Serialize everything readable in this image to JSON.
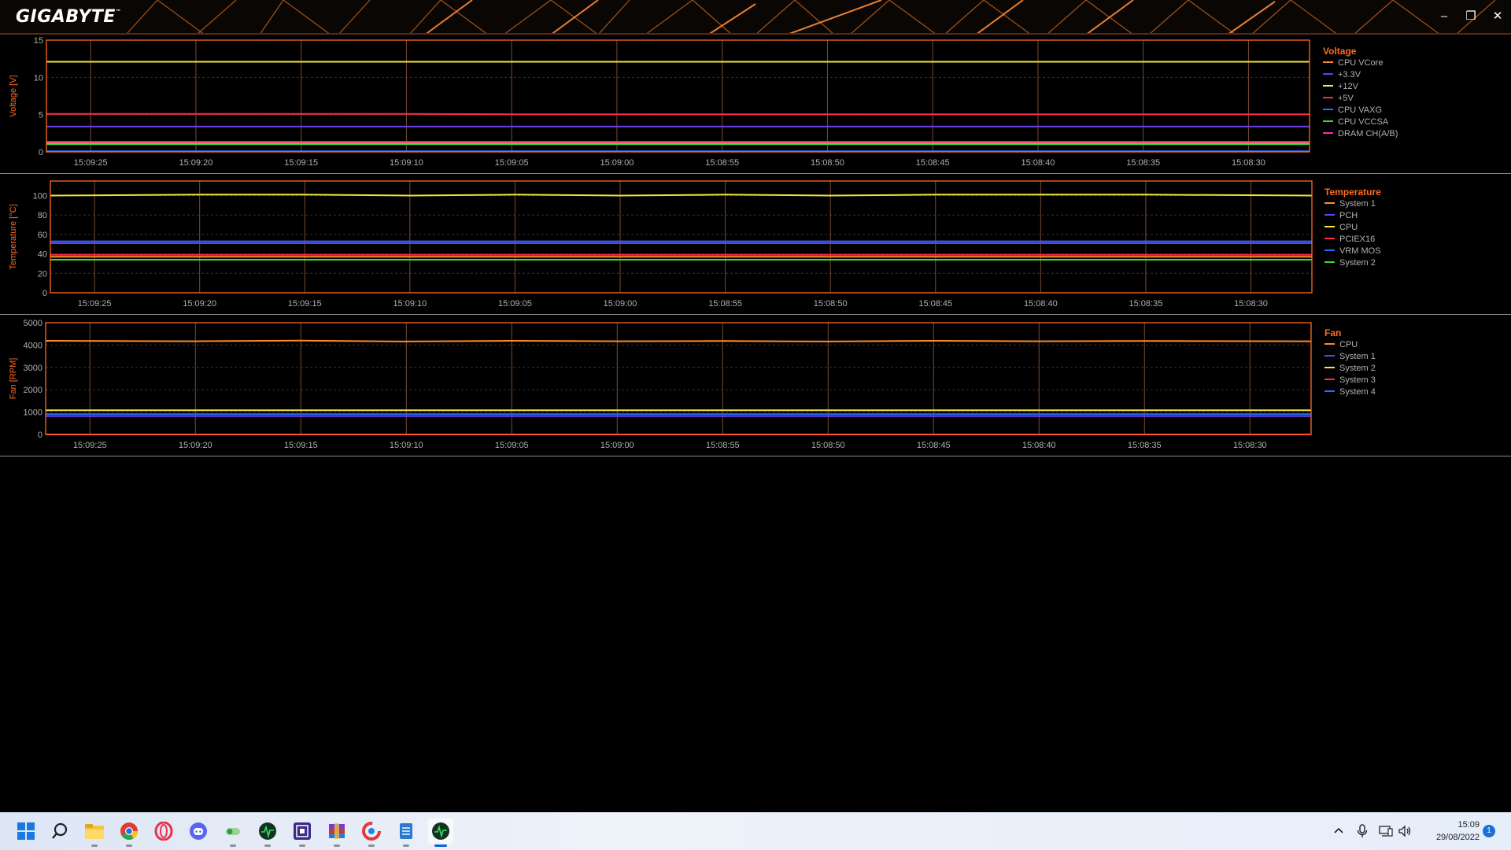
{
  "app": {
    "brand": "GIGABYTE",
    "trademark": "™"
  },
  "window_controls": {
    "minimize": "–",
    "restore": "❐",
    "close": "✕"
  },
  "time_labels": [
    "15:09:25",
    "15:09:20",
    "15:09:15",
    "15:09:10",
    "15:09:05",
    "15:09:00",
    "15:08:55",
    "15:08:50",
    "15:08:45",
    "15:08:40",
    "15:08:35",
    "15:08:30"
  ],
  "colors": {
    "accent": "#ff6a1f",
    "plot_border": "#ff6a1f",
    "grid_v": "#7a4a32",
    "grid_h": "#333333"
  },
  "chart_data": [
    {
      "type": "line",
      "title": "Voltage",
      "ylabel": "Voltage [V]",
      "ylim": [
        0,
        15
      ],
      "yticks": [
        "0",
        "5",
        "10",
        "15"
      ],
      "series": [
        {
          "name": "CPU VCore",
          "color": "#ff8a2a",
          "values": [
            1.2,
            1.2,
            1.2,
            1.2,
            1.2,
            1.2,
            1.2,
            1.2,
            1.2,
            1.2,
            1.2,
            1.2
          ]
        },
        {
          "name": "+3.3V",
          "color": "#6a3cf0",
          "values": [
            3.4,
            3.4,
            3.4,
            3.4,
            3.4,
            3.4,
            3.4,
            3.4,
            3.4,
            3.4,
            3.4,
            3.4
          ]
        },
        {
          "name": "+12V",
          "color": "#f2e63a",
          "values": [
            12.1,
            12.1,
            12.1,
            12.1,
            12.1,
            12.1,
            12.1,
            12.1,
            12.1,
            12.1,
            12.1,
            12.1
          ]
        },
        {
          "name": "+5V",
          "color": "#ff2a4a",
          "values": [
            5.1,
            5.1,
            5.1,
            5.1,
            5.05,
            5.05,
            5.05,
            5.05,
            5.05,
            5.05,
            5.05,
            5.05
          ]
        },
        {
          "name": "CPU VAXG",
          "color": "#2a6aff",
          "values": [
            0.1,
            0.1,
            0.1,
            0.1,
            0.1,
            0.1,
            0.1,
            0.1,
            0.1,
            0.1,
            0.1,
            0.1
          ]
        },
        {
          "name": "CPU VCCSA",
          "color": "#32e032",
          "values": [
            1.05,
            1.05,
            1.05,
            1.05,
            1.05,
            1.05,
            1.05,
            1.05,
            1.05,
            1.05,
            1.05,
            1.05
          ]
        },
        {
          "name": "DRAM CH(A/B)",
          "color": "#ff2ab4",
          "values": [
            1.35,
            1.35,
            1.35,
            1.35,
            1.35,
            1.35,
            1.35,
            1.35,
            1.35,
            1.35,
            1.35,
            1.35
          ]
        }
      ]
    },
    {
      "type": "line",
      "title": "Temperature",
      "ylabel": "Temperature [°C]",
      "ylim": [
        0,
        115
      ],
      "yticks": [
        "0",
        "20",
        "40",
        "60",
        "80",
        "100"
      ],
      "series": [
        {
          "name": "System 1",
          "color": "#ff8a2a",
          "values": [
            37,
            37,
            37,
            37,
            37,
            37,
            37,
            37,
            37,
            37,
            37,
            37
          ]
        },
        {
          "name": "PCH",
          "color": "#6a3cf0",
          "values": [
            51,
            51,
            51,
            51,
            51,
            51,
            51,
            51,
            51,
            51,
            51,
            51
          ]
        },
        {
          "name": "CPU",
          "color": "#f2e63a",
          "values": [
            100,
            101,
            101,
            100,
            101,
            100,
            101,
            100,
            101,
            101,
            101,
            100
          ]
        },
        {
          "name": "PCIEX16",
          "color": "#ff2a4a",
          "values": [
            39,
            39,
            39,
            39,
            39,
            39,
            39,
            39,
            39,
            39,
            39,
            39
          ]
        },
        {
          "name": "VRM MOS",
          "color": "#2a6aff",
          "values": [
            53,
            53,
            53,
            53,
            53,
            53,
            53,
            53,
            53,
            53,
            53,
            53
          ]
        },
        {
          "name": "System 2",
          "color": "#32e032",
          "values": [
            34,
            34,
            34,
            34,
            34,
            34,
            34,
            34,
            34,
            34,
            34,
            34
          ]
        }
      ]
    },
    {
      "type": "line",
      "title": "Fan",
      "ylabel": "Fan [RPM]",
      "ylim": [
        0,
        5000
      ],
      "yticks": [
        "0",
        "1000",
        "2000",
        "3000",
        "4000",
        "5000"
      ],
      "series": [
        {
          "name": "CPU",
          "color": "#ff8a2a",
          "values": [
            4190,
            4170,
            4200,
            4160,
            4190,
            4170,
            4180,
            4160,
            4190,
            4170,
            4180,
            4170
          ]
        },
        {
          "name": "System 1",
          "color": "#6a3cf0",
          "values": [
            820,
            820,
            820,
            820,
            820,
            820,
            820,
            820,
            820,
            820,
            820,
            820
          ]
        },
        {
          "name": "System 2",
          "color": "#f2e63a",
          "values": [
            1080,
            1080,
            1080,
            1080,
            1080,
            1080,
            1080,
            1080,
            1080,
            1080,
            1080,
            1080
          ]
        },
        {
          "name": "System 3",
          "color": "#ff2a4a",
          "values": [
            0,
            0,
            0,
            0,
            0,
            0,
            0,
            0,
            0,
            0,
            0,
            0
          ]
        },
        {
          "name": "System 4",
          "color": "#2a6aff",
          "values": [
            910,
            910,
            910,
            910,
            910,
            910,
            910,
            910,
            910,
            910,
            910,
            910
          ]
        }
      ]
    }
  ],
  "taskbar": {
    "apps": [
      "windows-start-icon",
      "search-icon",
      "file-explorer-icon",
      "chrome-icon",
      "opera-icon",
      "discord-icon",
      "toggle-app-icon",
      "gigabyte-monitor-icon",
      "capture-app-icon",
      "winrar-icon",
      "ccleaner-icon",
      "notepad-icon",
      "gigabyte-sensor-icon"
    ],
    "time": "15:09",
    "date": "29/08/2022",
    "notification_count": "1"
  }
}
